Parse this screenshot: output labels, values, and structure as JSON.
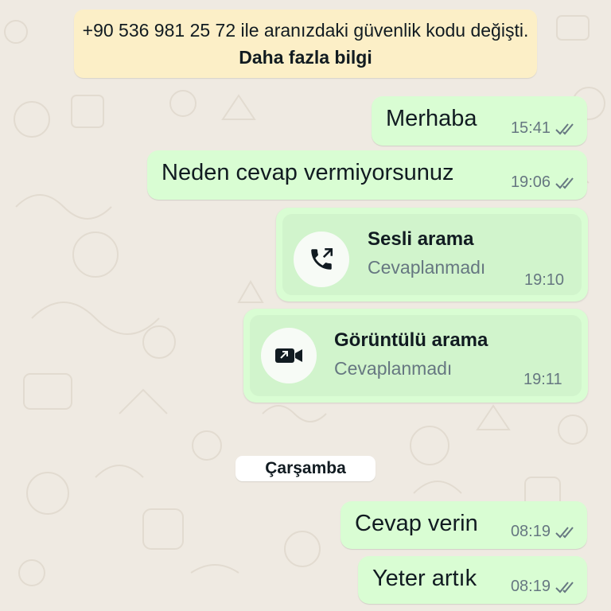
{
  "colors": {
    "background": "#efeae2",
    "outgoing_bubble": "#d9fdd3",
    "system_notice": "#fcefc7",
    "meta_text": "#667781"
  },
  "notice": {
    "text": "+90 536 981 25 72 ile aranızdaki güvenlik kodu değişti.",
    "link": "Daha fazla bilgi"
  },
  "messages": [
    {
      "text": "Merhaba",
      "time": "15:41",
      "status": "read-double-check-icon"
    },
    {
      "text": "Neden cevap vermiyorsunuz",
      "time": "19:06",
      "status": "read-double-check-icon"
    }
  ],
  "calls": [
    {
      "icon": "outgoing-voice-call-icon",
      "title": "Sesli arama",
      "subtitle": "Cevaplanmadı",
      "time": "19:10"
    },
    {
      "icon": "video-call-icon",
      "title": "Görüntülü arama",
      "subtitle": "Cevaplanmadı",
      "time": "19:11"
    }
  ],
  "date_separator": "Çarşamba",
  "messages_after": [
    {
      "text": "Cevap verin",
      "time": "08:19",
      "status": "read-double-check-icon"
    },
    {
      "text": "Yeter artık",
      "time": "08:19",
      "status": "read-double-check-icon"
    }
  ]
}
